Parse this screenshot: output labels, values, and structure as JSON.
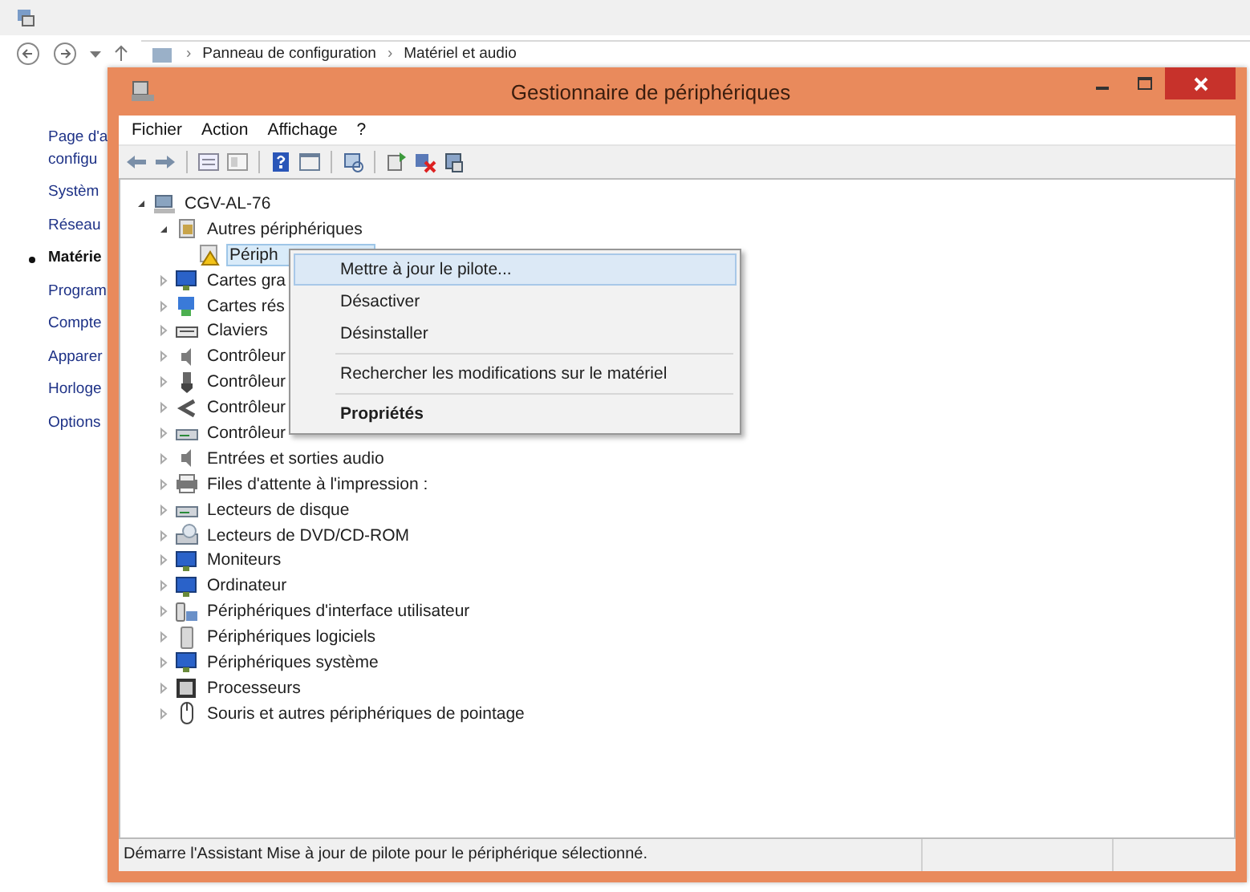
{
  "control_panel": {
    "breadcrumb": [
      {
        "kind": "separator",
        "text": "›"
      },
      {
        "kind": "link",
        "text": "Panneau de configuration"
      },
      {
        "kind": "separator",
        "text": "›"
      },
      {
        "kind": "link",
        "text": "Matériel et audio"
      }
    ],
    "sidebar": [
      {
        "label": "Page d'a",
        "selected": false
      },
      {
        "label": "configu",
        "selected": false
      },
      {
        "label": "Systèm",
        "selected": false
      },
      {
        "label": "Réseau",
        "selected": false
      },
      {
        "label": "Matérie",
        "selected": true
      },
      {
        "label": "Program",
        "selected": false
      },
      {
        "label": "Compte",
        "selected": false
      },
      {
        "label": "Apparer",
        "selected": false
      },
      {
        "label": "Horloge",
        "selected": false
      },
      {
        "label": "Options",
        "selected": false
      }
    ]
  },
  "window": {
    "title": "Gestionnaire de périphériques",
    "menu": [
      "Fichier",
      "Action",
      "Affichage",
      "?"
    ],
    "tree": [
      {
        "label": "CGV-AL-76",
        "kind": "computer",
        "expanded": true,
        "selected": false,
        "children": [
          {
            "label": "Autres périphériques",
            "kind": "unknown",
            "expanded": true,
            "selected": false,
            "children": [
              {
                "label": "Périph",
                "kind": "warning",
                "selected": true
              }
            ]
          },
          {
            "label": "Cartes gra",
            "kind": "display",
            "expanded": false,
            "selected": false
          },
          {
            "label": "Cartes rés",
            "kind": "network",
            "expanded": false,
            "selected": false
          },
          {
            "label": "Claviers",
            "kind": "keyboard",
            "expanded": false,
            "selected": false
          },
          {
            "label": "Contrôleur",
            "kind": "speaker",
            "expanded": false,
            "selected": false
          },
          {
            "label": "Contrôleur",
            "kind": "usb",
            "expanded": false,
            "selected": false
          },
          {
            "label": "Contrôleur",
            "kind": "port",
            "expanded": false,
            "selected": false
          },
          {
            "label": "Contrôleur",
            "kind": "drive",
            "expanded": false,
            "selected": false
          },
          {
            "label": "Entrées et sorties audio",
            "kind": "speaker",
            "expanded": false,
            "selected": false
          },
          {
            "label": "Files d'attente à l'impression :",
            "kind": "printer",
            "expanded": false,
            "selected": false
          },
          {
            "label": "Lecteurs de disque",
            "kind": "drive",
            "expanded": false,
            "selected": false
          },
          {
            "label": "Lecteurs de DVD/CD-ROM",
            "kind": "dvd",
            "expanded": false,
            "selected": false
          },
          {
            "label": "Moniteurs",
            "kind": "display",
            "expanded": false,
            "selected": false
          },
          {
            "label": "Ordinateur",
            "kind": "display",
            "expanded": false,
            "selected": false
          },
          {
            "label": "Périphériques d'interface utilisateur",
            "kind": "hid",
            "expanded": false,
            "selected": false
          },
          {
            "label": "Périphériques logiciels",
            "kind": "software",
            "expanded": false,
            "selected": false
          },
          {
            "label": "Périphériques système",
            "kind": "display",
            "expanded": false,
            "selected": false
          },
          {
            "label": "Processeurs",
            "kind": "cpu",
            "expanded": false,
            "selected": false
          },
          {
            "label": "Souris et autres périphériques de pointage",
            "kind": "mouse",
            "expanded": false,
            "selected": false
          }
        ]
      }
    ],
    "context_menu": [
      {
        "kind": "item",
        "label": "Mettre à jour le pilote...",
        "selected": true
      },
      {
        "kind": "item",
        "label": "Désactiver",
        "selected": false
      },
      {
        "kind": "item",
        "label": "Désinstaller",
        "selected": false
      },
      {
        "kind": "separator"
      },
      {
        "kind": "item",
        "label": "Rechercher les modifications sur le matériel",
        "selected": false
      },
      {
        "kind": "separator"
      },
      {
        "kind": "default",
        "label": "Propriétés",
        "selected": false
      }
    ],
    "status_bar": "Démarre l'Assistant Mise à jour de pilote pour le périphérique sélectionné."
  }
}
